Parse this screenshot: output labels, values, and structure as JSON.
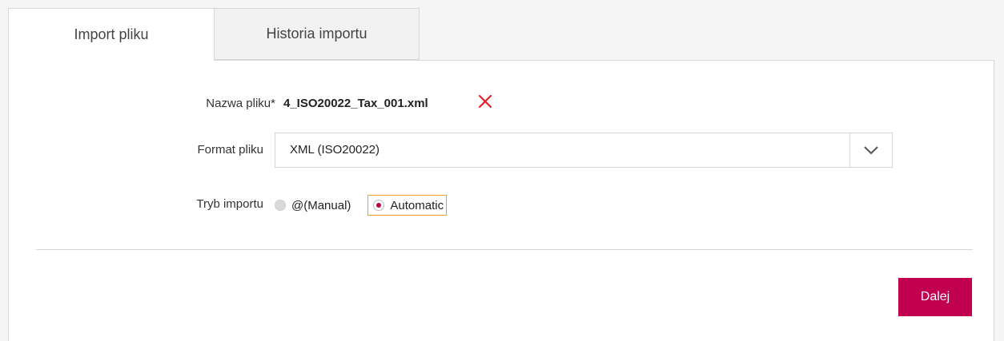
{
  "tabs": [
    {
      "label": "Import pliku",
      "active": true
    },
    {
      "label": "Historia importu",
      "active": false
    }
  ],
  "form": {
    "file_name": {
      "label": "Nazwa pliku*",
      "value": "4_ISO20022_Tax_001.xml",
      "remove_icon": "close-x-icon"
    },
    "file_format": {
      "label": "Format pliku",
      "selected": "XML (ISO20022)"
    },
    "import_mode": {
      "label": "Tryb importu",
      "options": [
        {
          "label": "@(Manual)",
          "selected": false
        },
        {
          "label": "Automatic",
          "selected": true
        }
      ]
    }
  },
  "actions": {
    "next_label": "Dalej"
  },
  "colors": {
    "accent": "#c1004f",
    "remove_icon": "#e8202a",
    "focus": "#f0a020"
  }
}
